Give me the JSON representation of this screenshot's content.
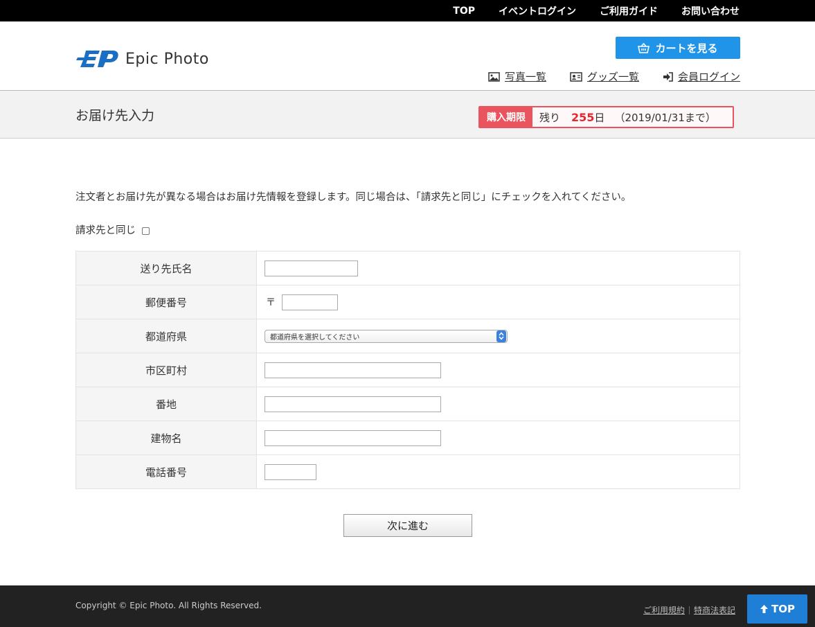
{
  "topnav": {
    "items": [
      "TOP",
      "イベントログイン",
      "ご利用ガイド",
      "お問い合わせ"
    ]
  },
  "header": {
    "logo_text": "Epic Photo",
    "cart_label": "カートを見る",
    "subnav": [
      {
        "label": "写真一覧",
        "icon": "image-icon"
      },
      {
        "label": "グッズ一覧",
        "icon": "id-card-icon"
      },
      {
        "label": "会員ログイン",
        "icon": "sign-in-icon"
      }
    ]
  },
  "titleband": {
    "page_title": "お届け先入力",
    "deadline_label": "購入期限",
    "remaining_prefix": "残り",
    "remaining_days": "255",
    "days_unit": "日",
    "until": "（2019/01/31まで）"
  },
  "content": {
    "intro": "注文者とお届け先が異なる場合はお届け先情報を登録します。同じ場合は、「請求先と同じ」にチェックを入れてください。",
    "same_as_billing_label": "請求先と同じ",
    "fields": {
      "name": {
        "label": "送り先氏名",
        "value": ""
      },
      "postal": {
        "label": "郵便番号",
        "mark": "〒",
        "value": ""
      },
      "prefecture": {
        "label": "都道府県",
        "selected": "都道府県を選択してください"
      },
      "city": {
        "label": "市区町村",
        "value": ""
      },
      "street": {
        "label": "番地",
        "value": ""
      },
      "building": {
        "label": "建物名",
        "value": ""
      },
      "phone": {
        "label": "電話番号",
        "value": ""
      }
    },
    "next_label": "次に進む"
  },
  "footer": {
    "copyright": "Copyright © Epic Photo. All Rights Reserved.",
    "terms": "ご利用規約",
    "law": "特商法表記",
    "top_label": "TOP"
  },
  "colors": {
    "accent_blue": "#1f94e8",
    "deadline_red": "#e9545e",
    "footer_bg": "#222222"
  }
}
